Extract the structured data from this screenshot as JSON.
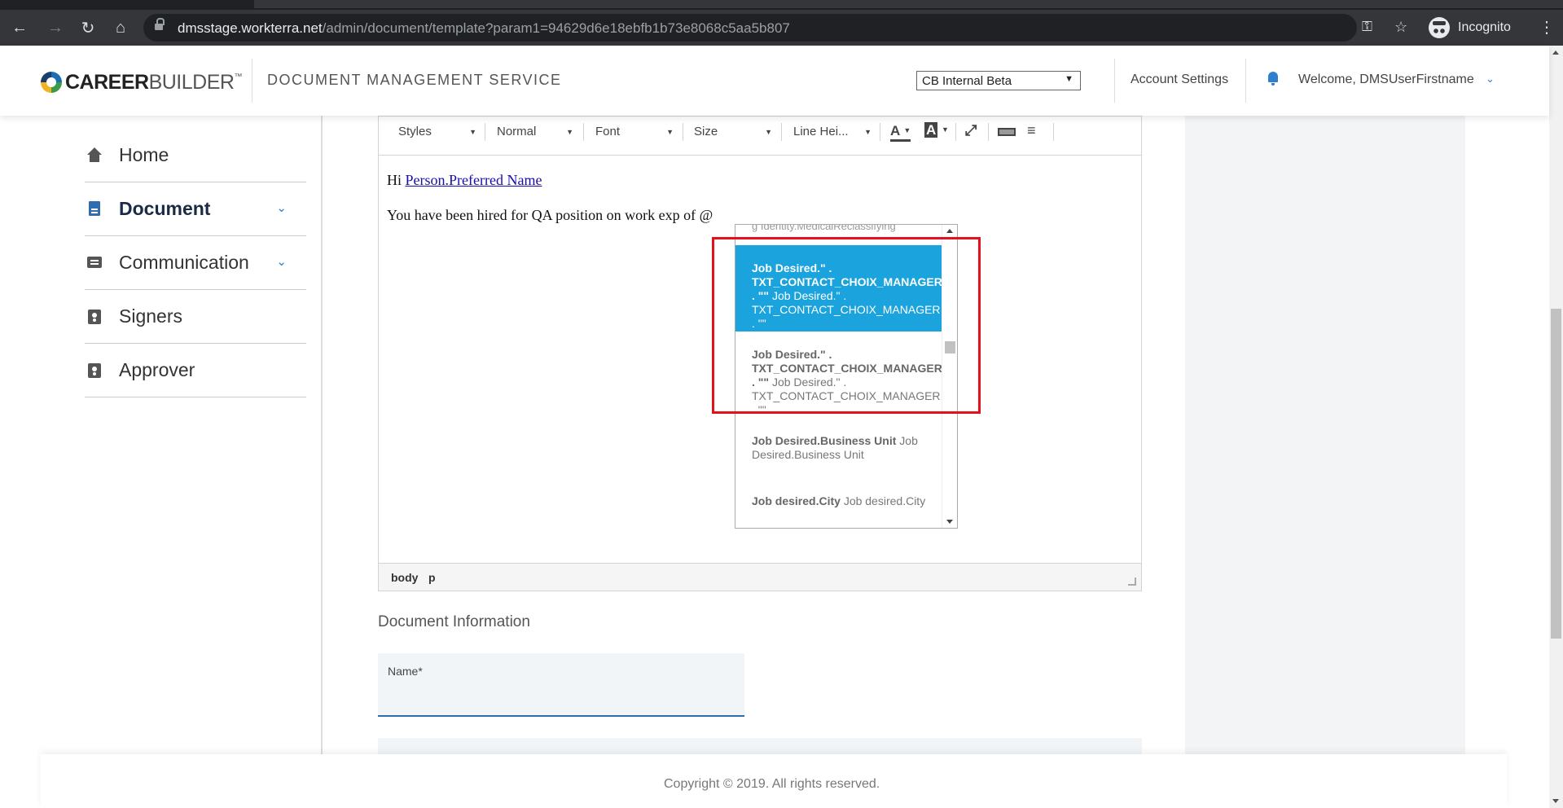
{
  "browser": {
    "url_host": "dmsstage.workterra.net",
    "url_path": "/admin/document/template?param1=94629d6e18ebfb1b73e8068c5aa5b807",
    "incognito_label": "Incognito",
    "icons": [
      "back-icon",
      "forward-icon",
      "reload-icon",
      "home-icon",
      "lock-icon",
      "key-icon",
      "star-icon",
      "incognito-icon",
      "menu-icon"
    ]
  },
  "header": {
    "logo_bold": "CAREER",
    "logo_light": "BUILDER",
    "logo_tm": "™",
    "service_title": "DOCUMENT MANAGEMENT SERVICE",
    "env_select_value": "CB Internal Beta",
    "account_settings": "Account Settings",
    "welcome": "Welcome, DMSUserFirstname"
  },
  "sidebar": {
    "items": [
      {
        "label": "Home",
        "icon": "home-icon"
      },
      {
        "label": "Document",
        "icon": "document-icon",
        "active": true
      },
      {
        "label": "Communication",
        "icon": "chat-icon"
      },
      {
        "label": "Signers",
        "icon": "badge-icon"
      },
      {
        "label": "Approver",
        "icon": "badge-icon"
      }
    ]
  },
  "editor": {
    "toolbar": {
      "styles": "Styles",
      "format": "Normal",
      "font": "Font",
      "size": "Size",
      "line_height": "Line Hei...",
      "text_color_glyph": "A",
      "bg_color_glyph": "A"
    },
    "line1_prefix": "Hi ",
    "line1_link": "Person.Preferred Name",
    "line2": "You have been hired for QA position on work exp of @",
    "status_path": [
      "body",
      "p"
    ]
  },
  "autocomplete": {
    "cut_item": "g Identity.MedicalReclassifying",
    "items": [
      {
        "bold": "Job Desired.\" . TXT_CONTACT_CHOIX_MANAGER . \"\"",
        "rest": "Job Desired.\" . TXT_CONTACT_CHOIX_MANAGER . \"\"",
        "selected": true
      },
      {
        "bold": "Job Desired.\" . TXT_CONTACT_CHOIX_MANAGER . \"\"",
        "rest": "Job Desired.\" . TXT_CONTACT_CHOIX_MANAGER . \"\"",
        "selected": false
      },
      {
        "bold": "Job Desired.Business Unit",
        "rest": "Job Desired.Business Unit",
        "selected": false
      },
      {
        "bold": "Job desired.City",
        "rest": "Job desired.City",
        "selected": false
      }
    ],
    "highlight_color": "#e4101b",
    "selected_color": "#1aa3dc"
  },
  "document_info": {
    "title": "Document Information",
    "name_label": "Name*"
  },
  "footer": {
    "copyright": "Copyright © 2019. All rights reserved."
  }
}
